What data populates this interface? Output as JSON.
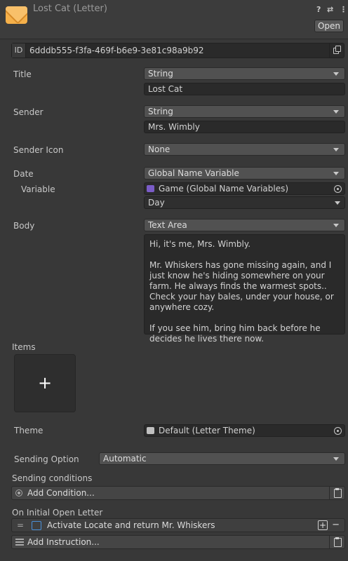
{
  "header": {
    "title": "Lost Cat (Letter)",
    "help_icon": "?",
    "settings_icon": "⇄",
    "menu_icon": "⋮",
    "open_label": "Open"
  },
  "id": {
    "label": "ID",
    "value": "6dddb555-f3fa-469f-b6e9-3e81c98a9b92"
  },
  "title_field": {
    "label": "Title",
    "type": "String",
    "value": "Lost Cat"
  },
  "sender": {
    "label": "Sender",
    "type": "String",
    "value": "Mrs. Wimbly"
  },
  "sender_icon": {
    "label": "Sender Icon",
    "type": "None"
  },
  "date": {
    "label": "Date",
    "type": "Global Name Variable",
    "variable_label": "Variable",
    "variable_value": "Game (Global Name Variables)",
    "sub_value": "Day"
  },
  "body": {
    "label": "Body",
    "type": "Text Area",
    "paragraphs": [
      "Hi, it's me, Mrs. Wimbly.",
      "Mr. Whiskers has gone missing again, and I just know he's hiding somewhere on your farm. He always finds the warmest spots.. Check your hay bales, under your house, or anywhere cozy.",
      "If you see him, bring him back before he decides he lives there now."
    ]
  },
  "items": {
    "label": "Items",
    "add_symbol": "+"
  },
  "theme": {
    "label": "Theme",
    "value": "Default (Letter Theme)"
  },
  "sending_option": {
    "label": "Sending Option",
    "value": "Automatic"
  },
  "sending_conditions": {
    "label": "Sending conditions",
    "add_label": "Add Condition..."
  },
  "on_open": {
    "label": "On Initial Open Letter",
    "handle": "=",
    "instruction": "Activate Locate and return Mr. Whiskers",
    "plus_symbol": "+",
    "minus_symbol": "−",
    "add_label": "Add Instruction..."
  },
  "colors": {
    "background": "#383838",
    "field": "#2a2a2a",
    "dropdown": "#515151",
    "envelope": "#f5b04a",
    "variable_icon": "#7a5cc7",
    "instruction_icon": "#4a90d9"
  }
}
